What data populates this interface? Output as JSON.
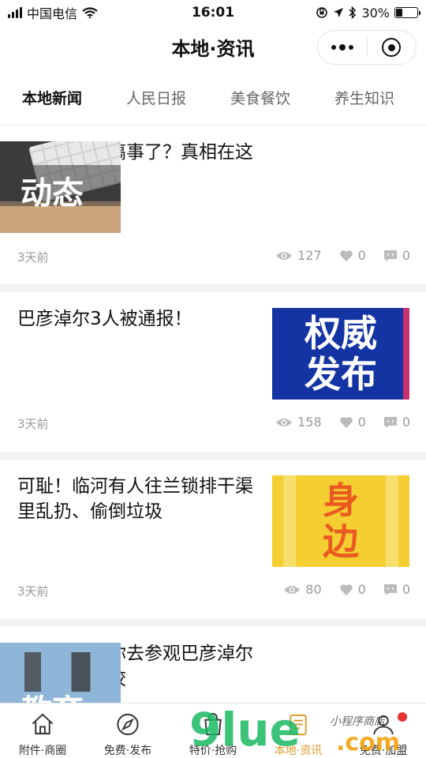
{
  "status_bar": {
    "carrier": "中国电信",
    "time": "16:01",
    "battery_percent": "30%",
    "battery_level": 0.3
  },
  "nav": {
    "title": "本地·资讯"
  },
  "tabs": [
    {
      "label": "本地新闻",
      "active": true
    },
    {
      "label": "人民日报",
      "active": false
    },
    {
      "label": "美食餐饮",
      "active": false
    },
    {
      "label": "养生知识",
      "active": false
    }
  ],
  "articles": [
    {
      "title": "刮刮乐又要搞事了？真相在这里！",
      "time": "3天前",
      "views": "127",
      "likes": "0",
      "comments": "0",
      "thumb_text": "动态"
    },
    {
      "title": "巴彦淖尔3人被通报！",
      "time": "3天前",
      "views": "158",
      "likes": "0",
      "comments": "0",
      "thumb_text_1": "权威",
      "thumb_text_2": "发布"
    },
    {
      "title": "可耻！临河有人往兰锁排干渠里乱扔、偷倒垃圾",
      "time": "3天前",
      "views": "80",
      "likes": "0",
      "comments": "0",
      "thumb_text_1": "身",
      "thumb_text_2": "边"
    },
    {
      "title": "来来来！带你去参观巴彦淖尔职业技术学校",
      "thumb_text": "教育"
    }
  ],
  "tab_bar": [
    {
      "label": "附件·商圈",
      "icon": "home-icon",
      "active": false
    },
    {
      "label": "免费·发布",
      "icon": "compass-icon",
      "active": false
    },
    {
      "label": "特价·抢购",
      "icon": "bag-icon",
      "active": false
    },
    {
      "label": "本地·资讯",
      "icon": "news-icon",
      "active": true
    },
    {
      "label": "免费·加盟",
      "icon": "user-icon",
      "active": false
    }
  ],
  "watermark": {
    "text_main": "9lue",
    "text_com": ".com",
    "text_cn": "小程序商店"
  },
  "colors": {
    "accent": "#e39a2e",
    "watermark_green": "#19b862",
    "watermark_orange": "#f5a20c"
  }
}
